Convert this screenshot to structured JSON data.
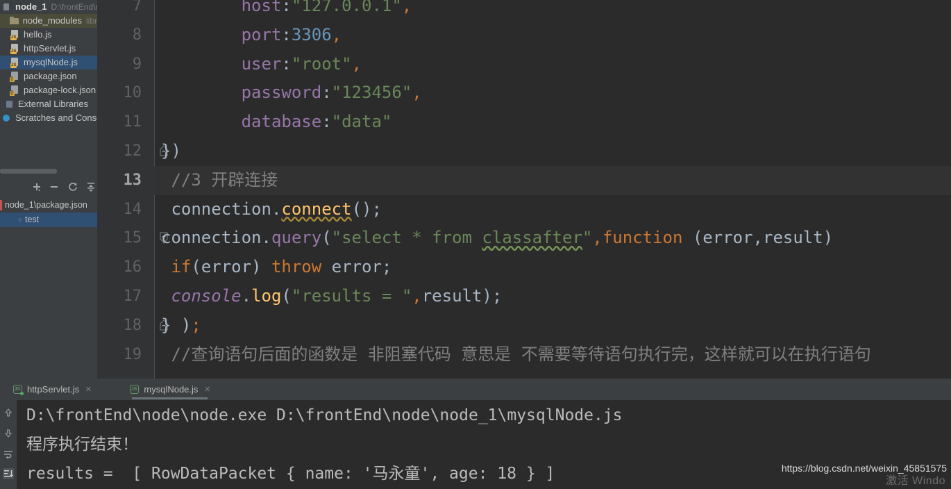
{
  "project_tree": {
    "items": [
      {
        "label": "node_1",
        "sub": "D:\\frontEnd\\n",
        "icon": "project-icon",
        "indent": 0,
        "bold": true,
        "state": "normal"
      },
      {
        "label": "node_modules",
        "sub": "libr",
        "icon": "folder-icon",
        "indent": 1,
        "bold": false,
        "state": "modified"
      },
      {
        "label": "hello.js",
        "sub": "",
        "icon": "js-file-icon",
        "indent": 1,
        "bold": false,
        "state": "normal"
      },
      {
        "label": "httpServlet.js",
        "sub": "",
        "icon": "js-file-icon",
        "indent": 1,
        "bold": false,
        "state": "normal"
      },
      {
        "label": "mysqlNode.js",
        "sub": "",
        "icon": "js-file-icon",
        "indent": 1,
        "bold": false,
        "state": "selected"
      },
      {
        "label": "package.json",
        "sub": "",
        "icon": "json-file-icon",
        "indent": 1,
        "bold": false,
        "state": "normal"
      },
      {
        "label": "package-lock.json",
        "sub": "",
        "icon": "json-file-icon",
        "indent": 1,
        "bold": false,
        "state": "normal"
      },
      {
        "label": "External Libraries",
        "sub": "",
        "icon": "library-icon",
        "indent": 0,
        "bold": false,
        "state": "normal"
      },
      {
        "label": "Scratches and Consoles",
        "sub": "",
        "icon": "scratches-icon",
        "indent": 0,
        "bold": false,
        "state": "normal"
      }
    ]
  },
  "run_toolbar": {
    "buttons": [
      {
        "name": "add-configuration-button",
        "icon": "plus-icon"
      },
      {
        "name": "remove-configuration-button",
        "icon": "minus-icon"
      },
      {
        "name": "rerun-button",
        "icon": "refresh-icon"
      },
      {
        "name": "expand-collapse-button",
        "icon": "collapse-icon"
      }
    ]
  },
  "run_tree": {
    "items": [
      {
        "label": "node_1\\package.json",
        "state": "normal",
        "marker": "red-bar"
      },
      {
        "label": "test",
        "state": "selected",
        "marker": "dot"
      }
    ]
  },
  "editor": {
    "lines": [
      {
        "number": "7",
        "caret": false,
        "fold": "",
        "tokens": [
          {
            "text": "        ",
            "cls": "t-ident"
          },
          {
            "text": "host",
            "cls": "t-prop"
          },
          {
            "text": ":",
            "cls": "t-punct"
          },
          {
            "text": "\"127.0.0.1\"",
            "cls": "t-str"
          },
          {
            "text": ",",
            "cls": "t-comma"
          }
        ]
      },
      {
        "number": "8",
        "caret": false,
        "fold": "",
        "tokens": [
          {
            "text": "        ",
            "cls": "t-ident"
          },
          {
            "text": "port",
            "cls": "t-prop"
          },
          {
            "text": ":",
            "cls": "t-punct"
          },
          {
            "text": "3306",
            "cls": "t-num"
          },
          {
            "text": ",",
            "cls": "t-comma"
          }
        ]
      },
      {
        "number": "9",
        "caret": false,
        "fold": "",
        "tokens": [
          {
            "text": "        ",
            "cls": "t-ident"
          },
          {
            "text": "user",
            "cls": "t-prop"
          },
          {
            "text": ":",
            "cls": "t-punct"
          },
          {
            "text": "\"root\"",
            "cls": "t-str"
          },
          {
            "text": ",",
            "cls": "t-comma"
          }
        ]
      },
      {
        "number": "10",
        "caret": false,
        "fold": "",
        "tokens": [
          {
            "text": "        ",
            "cls": "t-ident"
          },
          {
            "text": "password",
            "cls": "t-prop"
          },
          {
            "text": ":",
            "cls": "t-punct"
          },
          {
            "text": "\"123456\"",
            "cls": "t-str"
          },
          {
            "text": ",",
            "cls": "t-comma"
          }
        ]
      },
      {
        "number": "11",
        "caret": false,
        "fold": "",
        "tokens": [
          {
            "text": "        ",
            "cls": "t-ident"
          },
          {
            "text": "database",
            "cls": "t-prop"
          },
          {
            "text": ":",
            "cls": "t-punct"
          },
          {
            "text": "\"data\"",
            "cls": "t-str"
          }
        ]
      },
      {
        "number": "12",
        "caret": false,
        "fold": "collapse",
        "tokens": [
          {
            "text": "})",
            "cls": "t-punct"
          }
        ]
      },
      {
        "number": "13",
        "caret": true,
        "fold": "",
        "tokens": [
          {
            "text": " //3 开辟连接",
            "cls": "t-cmt"
          }
        ]
      },
      {
        "number": "14",
        "caret": false,
        "fold": "",
        "tokens": [
          {
            "text": " connection",
            "cls": "t-ident"
          },
          {
            "text": ".",
            "cls": "t-punct"
          },
          {
            "text": "connect",
            "cls": "t-fn squiggle-w"
          },
          {
            "text": "();",
            "cls": "t-punct"
          }
        ]
      },
      {
        "number": "15",
        "caret": false,
        "fold": "expand",
        "tokens": [
          {
            "text": "connection",
            "cls": "t-ident"
          },
          {
            "text": ".",
            "cls": "t-punct"
          },
          {
            "text": "query",
            "cls": "t-prop"
          },
          {
            "text": "(",
            "cls": "t-punct"
          },
          {
            "text": "\"select * from ",
            "cls": "t-str"
          },
          {
            "text": "classafter",
            "cls": "t-str squiggle"
          },
          {
            "text": "\"",
            "cls": "t-str"
          },
          {
            "text": ",",
            "cls": "t-comma"
          },
          {
            "text": "function",
            "cls": "t-kw"
          },
          {
            "text": " (error,result)",
            "cls": "t-punct"
          }
        ]
      },
      {
        "number": "16",
        "caret": false,
        "fold": "",
        "tokens": [
          {
            "text": " ",
            "cls": "t-ident"
          },
          {
            "text": "if",
            "cls": "t-kw"
          },
          {
            "text": "(error) ",
            "cls": "t-punct"
          },
          {
            "text": "throw",
            "cls": "t-kw"
          },
          {
            "text": " error;",
            "cls": "t-punct"
          }
        ]
      },
      {
        "number": "17",
        "caret": false,
        "fold": "",
        "tokens": [
          {
            "text": " ",
            "cls": "t-ident"
          },
          {
            "text": "console",
            "cls": "t-cls"
          },
          {
            "text": ".",
            "cls": "t-punct"
          },
          {
            "text": "log",
            "cls": "t-fn"
          },
          {
            "text": "(",
            "cls": "t-punct"
          },
          {
            "text": "\"results = \"",
            "cls": "t-str"
          },
          {
            "text": ",",
            "cls": "t-comma"
          },
          {
            "text": "result);",
            "cls": "t-punct"
          }
        ]
      },
      {
        "number": "18",
        "caret": false,
        "fold": "collapse",
        "tokens": [
          {
            "text": "} )",
            "cls": "t-punct"
          },
          {
            "text": ";",
            "cls": "t-semi"
          }
        ]
      },
      {
        "number": "19",
        "caret": false,
        "fold": "",
        "tokens": [
          {
            "text": " //查询语句后面的函数是 非阻塞代码 意思是 不需要等待语句执行完，这样就可以在执行语句",
            "cls": "t-cmt"
          }
        ]
      }
    ]
  },
  "console_tabs": [
    {
      "label": "httpServlet.js",
      "active": false,
      "running": true,
      "close": "×",
      "icon": "js-tab-icon"
    },
    {
      "label": "mysqlNode.js",
      "active": true,
      "running": false,
      "close": "×",
      "icon": "js-tab-icon"
    }
  ],
  "console_gutter": [
    {
      "name": "scroll-up-button",
      "icon": "arrow-up-icon",
      "active": false
    },
    {
      "name": "scroll-down-button",
      "icon": "arrow-down-icon",
      "active": false
    },
    {
      "name": "soft-wrap-button",
      "icon": "soft-wrap-icon",
      "active": false
    },
    {
      "name": "scroll-to-end-button",
      "icon": "scroll-to-end-icon",
      "active": true
    }
  ],
  "console_output": {
    "lines": [
      "D:\\frontEnd\\node\\node.exe D:\\frontEnd\\node\\node_1\\mysqlNode.js",
      "程序执行结束！",
      "results =  [ RowDataPacket { name: '马永童', age: 18 } ]"
    ]
  },
  "watermark": {
    "url": "https://blog.csdn.net/weixin_45851575",
    "overlay": "激活 Windo"
  },
  "colors": {
    "editor_bg": "#2b2b2b",
    "gutter_bg": "#313335",
    "panel_bg": "#3c3f41",
    "selection": "#2f4f73",
    "string": "#6a8759",
    "keyword": "#cc7832",
    "property": "#9876aa",
    "number": "#6897bb",
    "function": "#ffc66d",
    "comment": "#808080",
    "default_text": "#a9b7c6"
  }
}
